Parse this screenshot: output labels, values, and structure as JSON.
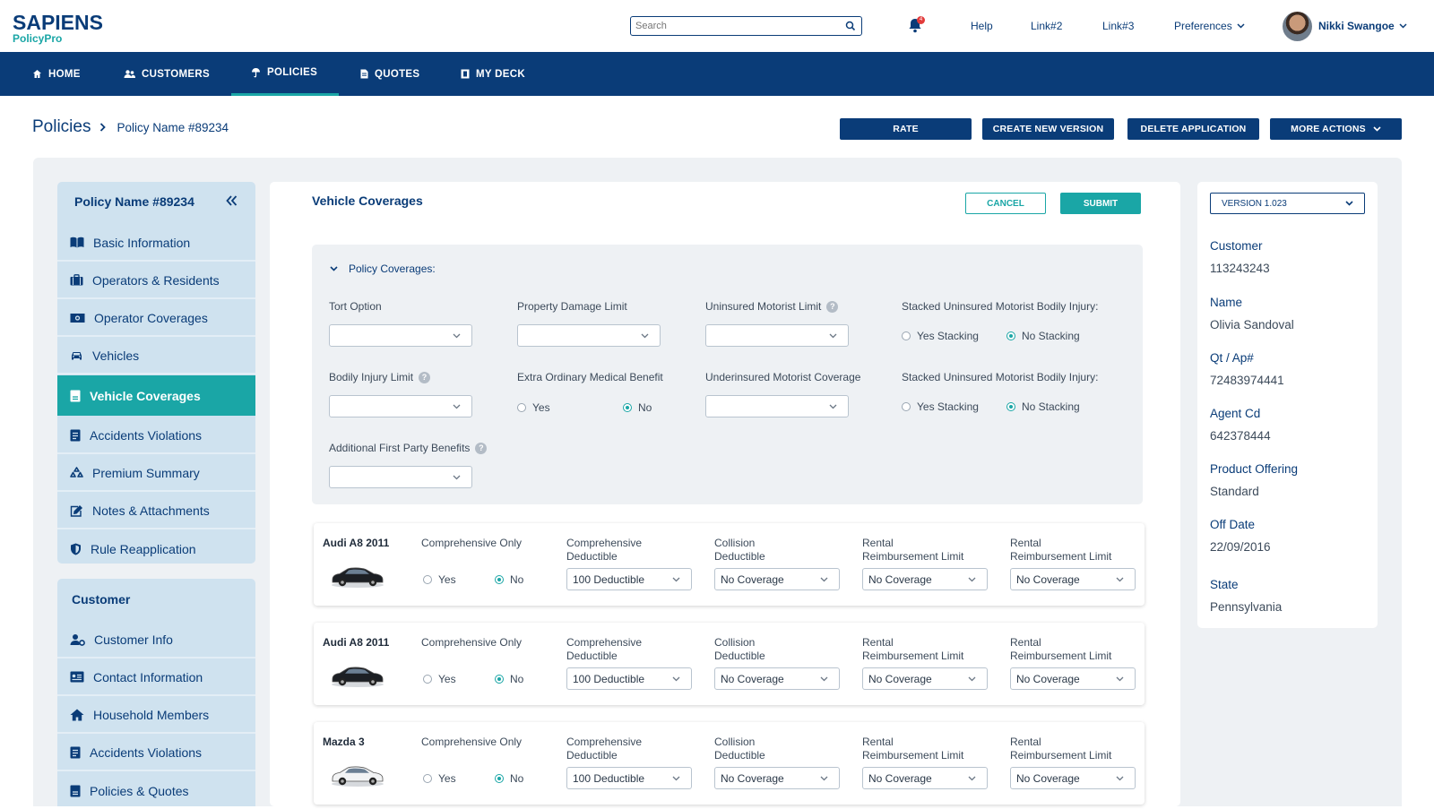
{
  "logo": {
    "brand": "SAPIENS",
    "product": "PolicyPro"
  },
  "search": {
    "placeholder": "Search"
  },
  "notifications": {
    "count": "4"
  },
  "top_links": {
    "help": "Help",
    "link2": "Link#2",
    "link3": "Link#3",
    "preferences": "Preferences"
  },
  "user": {
    "name": "Nikki Swangoe"
  },
  "nav": {
    "home": "HOME",
    "customers": "CUSTOMERS",
    "policies": "POLICIES",
    "quotes": "QUOTES",
    "my_deck": "MY DECK"
  },
  "breadcrumb": {
    "root": "Policies",
    "current": "Policy Name #89234"
  },
  "actions": {
    "rate": "RATE",
    "create_version": "CREATE NEW VERSION",
    "delete_application": "DELETE APPLICATION",
    "more_actions": "MORE ACTIONS"
  },
  "sidebar": {
    "policy_title": "Policy Name #89234",
    "policy_items": [
      {
        "label": "Basic Information",
        "icon": "book-icon"
      },
      {
        "label": "Operators & Residents",
        "icon": "briefcase-icon"
      },
      {
        "label": "Operator Coverages",
        "icon": "money-icon"
      },
      {
        "label": "Vehicles",
        "icon": "car-icon"
      },
      {
        "label": "Vehicle Coverages",
        "icon": "document-icon"
      },
      {
        "label": "Accidents Violations",
        "icon": "clipboard-icon"
      },
      {
        "label": "Premium Summary",
        "icon": "recycle-icon"
      },
      {
        "label": "Notes & Attachments",
        "icon": "edit-icon"
      },
      {
        "label": "Rule Reapplication",
        "icon": "shield-icon"
      }
    ],
    "customer_title": "Customer",
    "customer_items": [
      {
        "label": "Customer Info",
        "icon": "user-gear-icon"
      },
      {
        "label": "Contact Information",
        "icon": "id-card-icon"
      },
      {
        "label": "Household Members",
        "icon": "house-icon"
      },
      {
        "label": "Accidents Violations",
        "icon": "clipboard-icon"
      },
      {
        "label": "Policies & Quotes",
        "icon": "document-icon"
      }
    ]
  },
  "main": {
    "title": "Vehicle Coverages",
    "cancel": "CANCEL",
    "submit": "SUBMIT",
    "policy_coverages": {
      "header": "Policy Coverages:",
      "tort_option": "Tort Option",
      "property_damage_limit": "Property Damage Limit",
      "uninsured_motorist_limit": "Uninsured Motorist Limit",
      "stacked_um_1": "Stacked Uninsured Motorist Bodily Injury:",
      "bodily_injury_limit": "Bodily Injury Limit",
      "extra_medical": "Extra Ordinary Medical Benefit",
      "underinsured_motorist": "Underinsured Motorist Coverage",
      "stacked_um_2": "Stacked Uninsured Motorist Bodily Injury:",
      "additional_first_party": "Additional First Party Benefits",
      "yes": "Yes",
      "no": "No",
      "yes_stacking": "Yes Stacking",
      "no_stacking": "No Stacking"
    },
    "vehicle_labels": {
      "comprehensive_only": "Comprehensive Only",
      "comp_ded_1": "Comprehensive",
      "comp_ded_2": "Deductible",
      "coll_ded_1": "Collision",
      "coll_ded_2": "Deductible",
      "rental_1": "Rental",
      "rental_2": "Reimbursement Limit",
      "yes": "Yes",
      "no": "No"
    },
    "vehicles": [
      {
        "name": "Audi A8 2011",
        "comp_deductible": "100 Deductible",
        "collision": "No Coverage",
        "rental_a": "No Coverage",
        "rental_b": "No Coverage",
        "car_color": "#1c1f24"
      },
      {
        "name": "Audi A8 2011",
        "comp_deductible": "100 Deductible",
        "collision": "No Coverage",
        "rental_a": "No Coverage",
        "rental_b": "No Coverage",
        "car_color": "#1c1f24"
      },
      {
        "name": "Mazda 3",
        "comp_deductible": "100 Deductible",
        "collision": "No Coverage",
        "rental_a": "No Coverage",
        "rental_b": "No Coverage",
        "car_color": "#f2f3f4"
      }
    ]
  },
  "details": {
    "version": "VERSION 1.023",
    "customer_label": "Customer",
    "customer_value": "113243243",
    "name_label": "Name",
    "name_value": "Olivia Sandoval",
    "qt_label": "Qt / Ap#",
    "qt_value": "72483974441",
    "agent_label": "Agent Cd",
    "agent_value": "642378444",
    "product_label": "Product Offering",
    "product_value": "Standard",
    "offdate_label": "Off Date",
    "offdate_value": "22/09/2016",
    "state_label": "State",
    "state_value": "Pennsylvania"
  },
  "colors": {
    "primary": "#0a3c78",
    "accent": "#1aa6a6",
    "sidebar_bg": "#cfe2ef"
  }
}
